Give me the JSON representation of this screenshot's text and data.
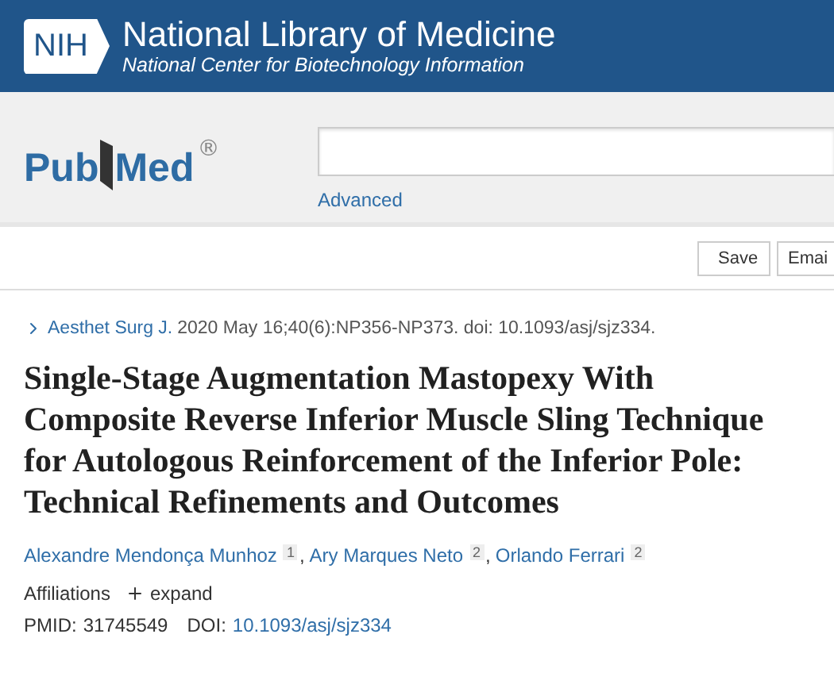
{
  "header": {
    "badge": "NIH",
    "title": "National Library of Medicine",
    "subtitle": "National Center for Biotechnology Information"
  },
  "search": {
    "logo": {
      "left": "Pub",
      "right": "Med",
      "mark": "®"
    },
    "advanced": "Advanced"
  },
  "actions": [
    "Save",
    "Emai"
  ],
  "citation": {
    "journal": "Aesthet Surg J.",
    "details": "2020 May 16;40(6):NP356-NP373. doi: 10.1093/asj/sjz334."
  },
  "title": "Single-Stage Augmentation Mastopexy With Composite Reverse Inferior Muscle Sling Technique for Autologous Reinforcement of the Inferior Pole: Technical Refinements and Outcomes",
  "authors": [
    {
      "name": "Alexandre Mendonça Munhoz",
      "ref": "1",
      "separator": ","
    },
    {
      "name": "Ary Marques Neto",
      "ref": "2",
      "separator": ","
    },
    {
      "name": "Orlando Ferrari",
      "ref": "2"
    }
  ],
  "affiliations": {
    "label": "Affiliations",
    "toggle": "expand"
  },
  "ids": {
    "pmid_label": "PMID:",
    "pmid": "31745549",
    "doi_label": "DOI:",
    "doi": "10.1093/asj/sjz334"
  }
}
